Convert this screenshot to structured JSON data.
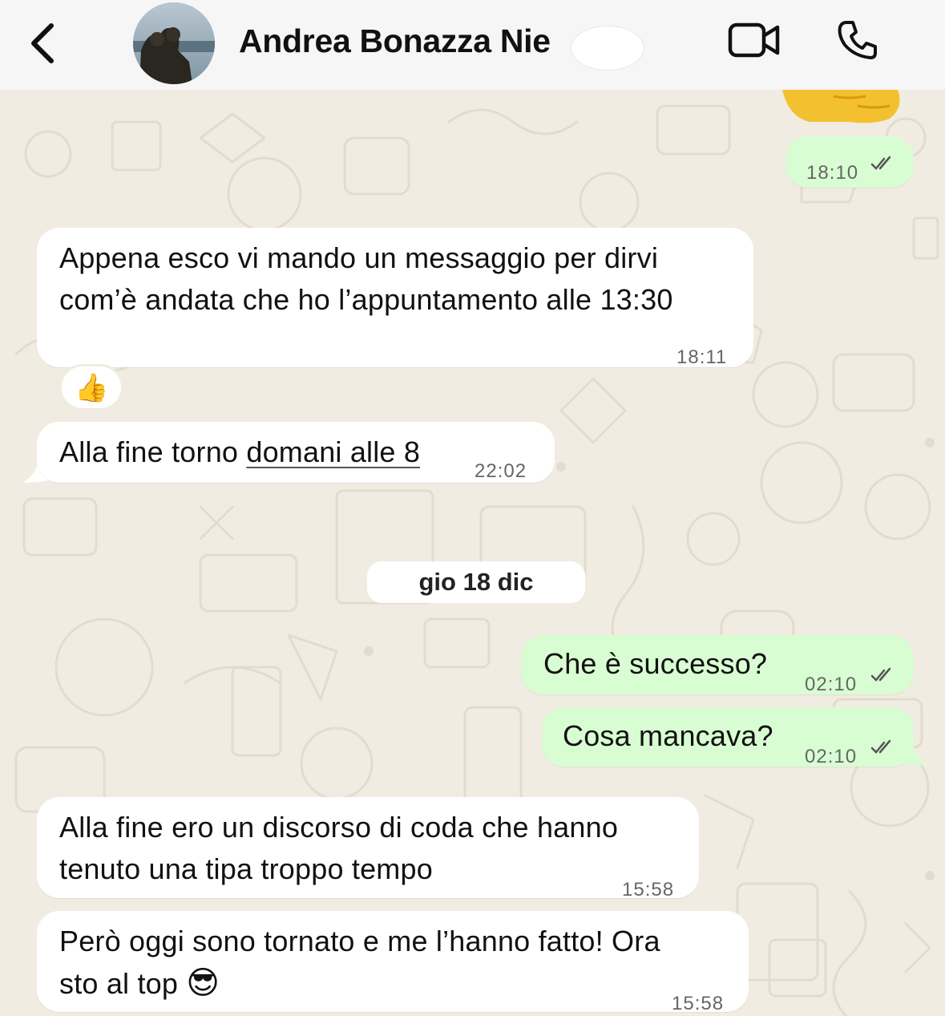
{
  "header": {
    "contact_name": "Andrea Bonazza Nie",
    "back_icon": "chevron-left-icon",
    "video_icon": "video-call-icon",
    "phone_icon": "phone-call-icon"
  },
  "colors": {
    "incoming_bubble": "#ffffff",
    "outgoing_bubble": "#d9fdd3",
    "wallpaper": "#f1ece2",
    "read_ticks": "#555555"
  },
  "messages": [
    {
      "direction": "out",
      "content": "thumbs-up-emoji-sticker",
      "time": "18:10",
      "status": "read"
    },
    {
      "direction": "in",
      "lines": [
        "Appena esco vi mando un messaggio per dirvi",
        "com’è andata che ho l’appuntamento alle 13:30"
      ],
      "time": "18:11",
      "reaction": "👍"
    },
    {
      "direction": "in",
      "text_prefix": "Alla fine torno ",
      "text_link": "domani alle 8",
      "time": "22:02"
    },
    {
      "direction": "out",
      "text": "Che è successo?",
      "time": "02:10",
      "status": "read"
    },
    {
      "direction": "out",
      "text": "Cosa mancava?",
      "time": "02:10",
      "status": "read"
    },
    {
      "direction": "in",
      "lines": [
        "Alla fine ero un discorso di coda che hanno",
        "tenuto una tipa troppo tempo"
      ],
      "time": "15:58"
    },
    {
      "direction": "in",
      "lines": [
        "Però oggi sono tornato e me l’hanno fatto! Ora",
        "sto al top"
      ],
      "emoji": "😎",
      "time": "15:58"
    }
  ],
  "date_separator": "gio 18 dic"
}
